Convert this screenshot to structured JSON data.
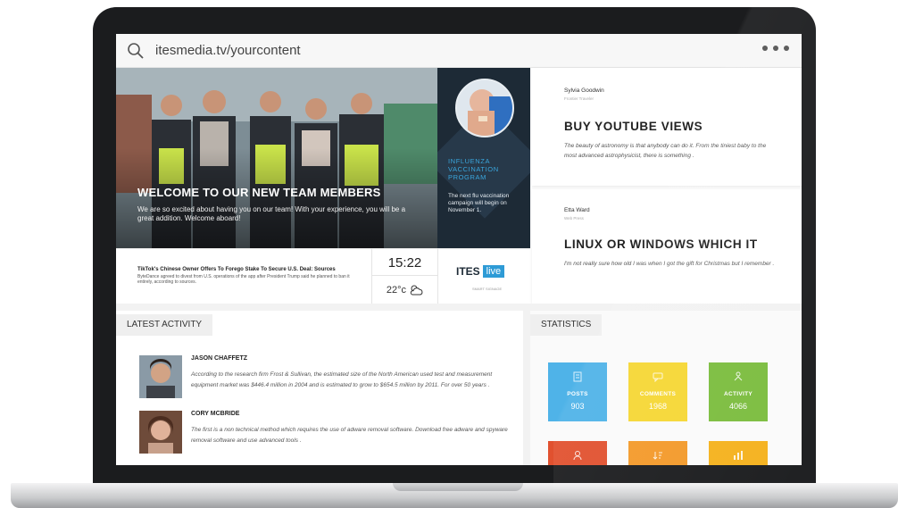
{
  "browser": {
    "url": "itesmedia.tv/yourcontent"
  },
  "hero": {
    "title": "WELCOME TO OUR NEW TEAM MEMBERS",
    "text": "We are so excited about having you on our team! With your experience, you will be a great addition. Welcome aboard!"
  },
  "vaccination": {
    "title": "INFLUENZA VACCINATION PROGRAM",
    "text": "The next flu vaccination campaign will begin on November 1."
  },
  "ticker": {
    "headline": "TikTok's Chinese Owner Offers To Forego Stake To Secure U.S. Deal: Sources",
    "text": "ByteDance agreed to divest from U.S. operations of the app after President Trump said he planned to ban it entirely, according to sources."
  },
  "clock": {
    "time": "15:22",
    "temperature": "22°c",
    "weather_icon": "partly-cloudy-icon"
  },
  "logo": {
    "name": "ITES",
    "badge": "live",
    "tagline": "SMART SIGNAGE"
  },
  "posts": [
    {
      "author": "Sylvia Goodwin",
      "role": "Frontier Traveler",
      "title": "BUY YOUTUBE VIEWS",
      "excerpt": "The beauty of astronomy is that anybody can do it. From the tiniest baby to the most advanced astrophysicist, there is something ."
    },
    {
      "author": "Etta Ward",
      "role": "Web Press",
      "title": "LINUX OR WINDOWS WHICH IT",
      "excerpt": "I'm not really sure how old I was when I got the gift for Christmas but I remember ."
    }
  ],
  "activity": {
    "tab_label": "LATEST ACTIVITY",
    "items": [
      {
        "name": "JASON CHAFFETZ",
        "text": "According to the research firm Frost & Sullivan, the estimated size of the North American used test and measurement equipment market was $446.4 million in 2004 and is estimated to grow to $654.5 million by 2011. For over 50 years ."
      },
      {
        "name": "CORY MCBRIDE",
        "text": "The first is a non technical method which requires the use of adware removal software. Download free adware and spyware removal software and use advanced tools ."
      }
    ]
  },
  "statistics": {
    "tab_label": "STATISTICS",
    "tiles": [
      {
        "label": "POSTS",
        "value": "903",
        "color": "#4fb3e8",
        "icon": "document-icon"
      },
      {
        "label": "COMMENTS",
        "value": "1968",
        "color": "#f6d735",
        "icon": "comment-icon"
      },
      {
        "label": "ACTIVITY",
        "value": "4066",
        "color": "#7cbd3f",
        "icon": "activity-icon"
      },
      {
        "label": "",
        "value": "",
        "color": "#e1512f",
        "icon": "user-icon"
      },
      {
        "label": "",
        "value": "",
        "color": "#f39a2b",
        "icon": "sort-icon"
      },
      {
        "label": "",
        "value": "",
        "color": "#f5b21e",
        "icon": "chart-icon"
      }
    ]
  },
  "colors": {
    "accent_blue": "#2e9bd6",
    "navy": "#1d2a36"
  }
}
